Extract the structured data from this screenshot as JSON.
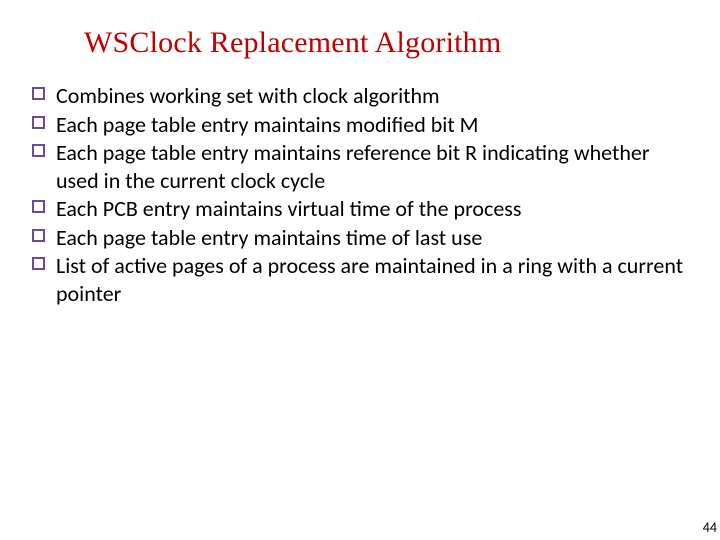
{
  "title": "WSClock Replacement Algorithm",
  "bullets": [
    "Combines working set with clock algorithm",
    "Each page table entry maintains modified bit M",
    "Each page table entry maintains reference bit R indicating whether used in the current clock cycle",
    "Each PCB entry maintains virtual time of the process",
    "Each page table entry maintains time of last use",
    "List of active pages of a process are maintained in a ring with a current pointer"
  ],
  "page_number": "44"
}
